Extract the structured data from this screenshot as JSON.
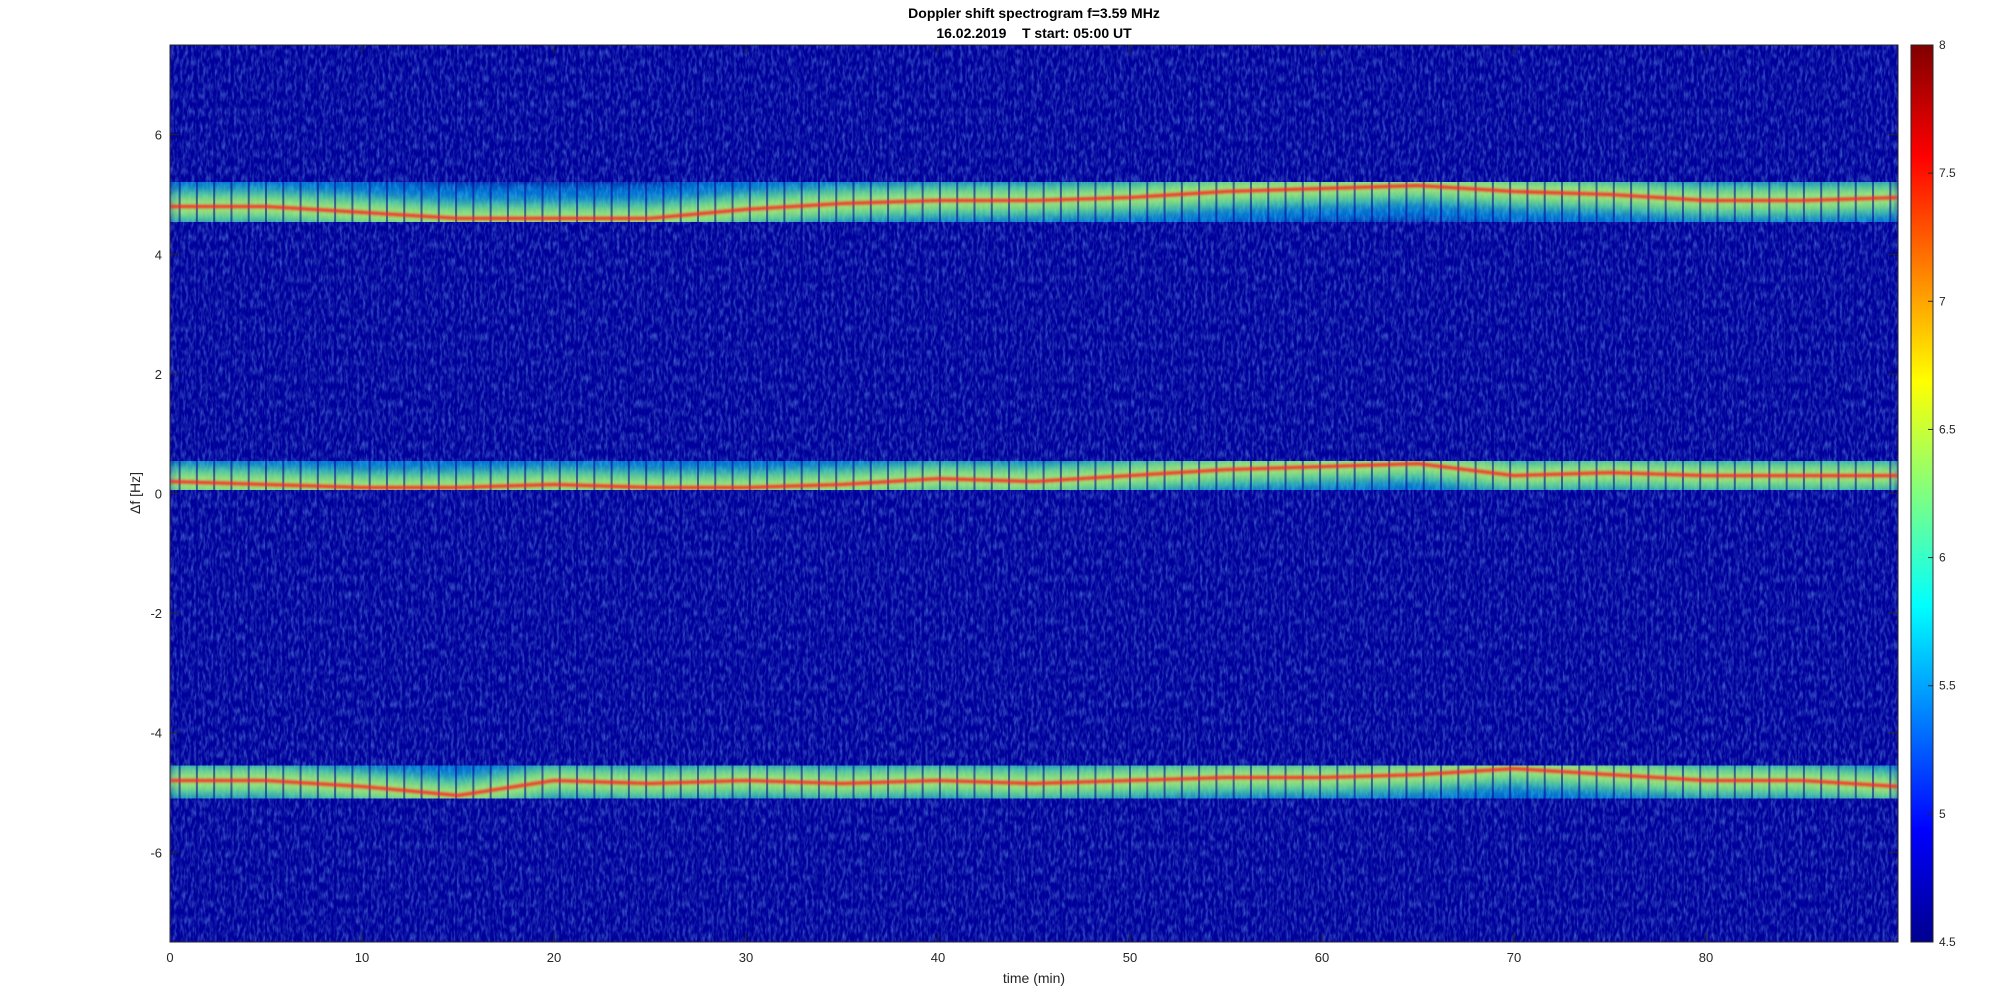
{
  "chart_data": {
    "type": "heatmap",
    "title": "Doppler shift spectrogram f=3.59 MHz",
    "subtitle": "16.02.2019    T start: 05:00 UT",
    "xlabel": "time (min)",
    "ylabel": "Δf [Hz]",
    "xlim": [
      0,
      90
    ],
    "ylim": [
      -7.5,
      7.5
    ],
    "xticks": [
      "0",
      "10",
      "20",
      "30",
      "40",
      "50",
      "60",
      "70",
      "80"
    ],
    "xtick_values": [
      0,
      10,
      20,
      30,
      40,
      50,
      60,
      70,
      80
    ],
    "yticks": [
      "6",
      "4",
      "2",
      "0",
      "-2",
      "-4",
      "-6"
    ],
    "ytick_values": [
      6,
      4,
      2,
      0,
      -2,
      -4,
      -6
    ],
    "colormap": "jet",
    "clim": [
      4.5,
      8
    ],
    "colorbar_ticks": [
      "8",
      "7.5",
      "7",
      "6.5",
      "6",
      "5.5",
      "5",
      "4.5"
    ],
    "colorbar_tick_values": [
      8,
      7.5,
      7,
      6.5,
      6,
      5.5,
      5,
      4.5
    ],
    "grid": false,
    "series": [
      {
        "x": [
          0,
          5,
          10,
          15,
          20,
          25,
          30,
          35,
          40,
          45,
          50,
          55,
          60,
          65,
          70,
          75,
          80,
          85,
          90
        ],
        "y": [
          4.8,
          4.8,
          4.7,
          4.6,
          4.6,
          4.6,
          4.75,
          4.85,
          4.9,
          4.9,
          4.95,
          5.05,
          5.1,
          5.15,
          5.05,
          5.0,
          4.9,
          4.9,
          4.95
        ]
      },
      {
        "x": [
          0,
          5,
          10,
          15,
          20,
          25,
          30,
          35,
          40,
          45,
          50,
          55,
          60,
          65,
          70,
          75,
          80,
          85,
          90
        ],
        "y": [
          0.2,
          0.15,
          0.1,
          0.1,
          0.15,
          0.1,
          0.1,
          0.15,
          0.25,
          0.2,
          0.3,
          0.4,
          0.45,
          0.5,
          0.3,
          0.35,
          0.3,
          0.3,
          0.3
        ]
      },
      {
        "x": [
          0,
          5,
          10,
          15,
          20,
          25,
          30,
          35,
          40,
          45,
          50,
          55,
          60,
          65,
          70,
          75,
          80,
          85,
          90
        ],
        "y": [
          -4.8,
          -4.8,
          -4.9,
          -5.05,
          -4.8,
          -4.85,
          -4.8,
          -4.85,
          -4.8,
          -4.85,
          -4.8,
          -4.75,
          -4.75,
          -4.7,
          -4.6,
          -4.7,
          -4.8,
          -4.8,
          -4.9
        ]
      }
    ]
  }
}
